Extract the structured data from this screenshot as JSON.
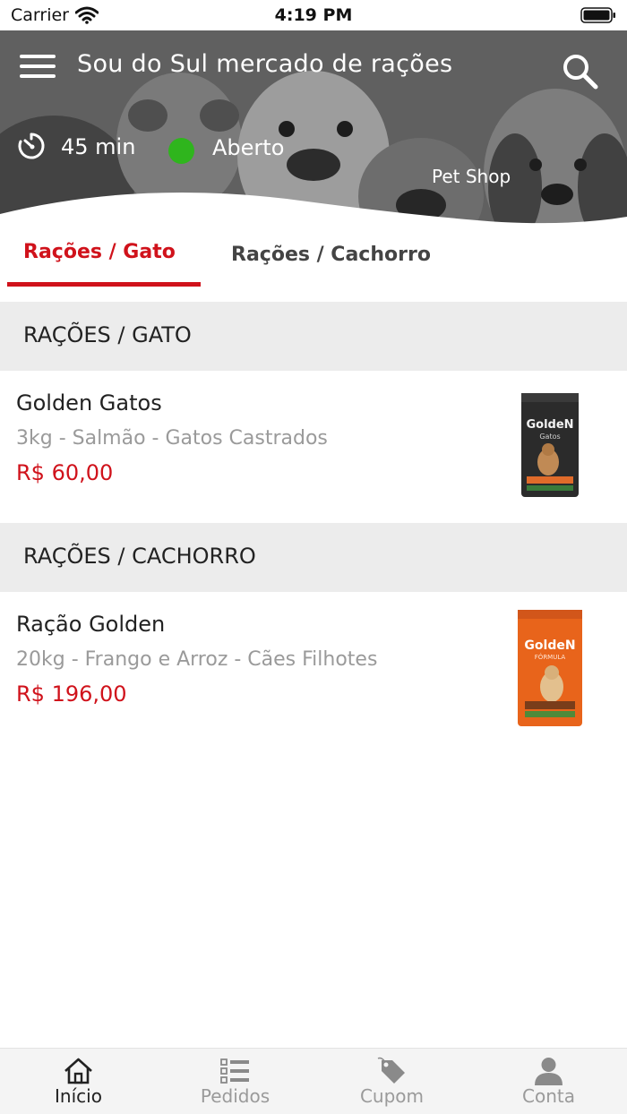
{
  "status_bar": {
    "carrier": "Carrier",
    "time": "4:19 PM"
  },
  "header": {
    "store_name": "Sou do Sul mercado de rações",
    "delivery_time": "45 min",
    "open_status": "Aberto",
    "open_status_color": "#2fb51d",
    "category": "Pet Shop"
  },
  "tabs": [
    {
      "label": "Rações / Gato",
      "active": true
    },
    {
      "label": "Rações / Cachorro",
      "active": false
    }
  ],
  "sections": [
    {
      "title": "RAÇÕES / GATO",
      "products": [
        {
          "name": "Golden Gatos",
          "description": "3kg - Salmão - Gatos Castrados",
          "price": "R$ 60,00",
          "image": {
            "brand": "GoldeN",
            "subtitle": "Gatos",
            "color": "#2b2b2b"
          }
        }
      ]
    },
    {
      "title": "RAÇÕES / CACHORRO",
      "products": [
        {
          "name": "Ração Golden",
          "description": "20kg - Frango e Arroz - Cães Filhotes",
          "price": "R$ 196,00",
          "image": {
            "brand": "GoldeN",
            "subtitle": "FÓRMULA",
            "color": "#e8641b"
          }
        }
      ]
    }
  ],
  "bottom_nav": [
    {
      "label": "Início",
      "icon": "home-icon",
      "active": true
    },
    {
      "label": "Pedidos",
      "icon": "orders-list-icon",
      "active": false
    },
    {
      "label": "Cupom",
      "icon": "coupon-tag-icon",
      "active": false
    },
    {
      "label": "Conta",
      "icon": "account-user-icon",
      "active": false
    }
  ],
  "colors": {
    "accent": "#d0121b",
    "section_bg": "#ececec",
    "muted_text": "#9a9a9a"
  }
}
